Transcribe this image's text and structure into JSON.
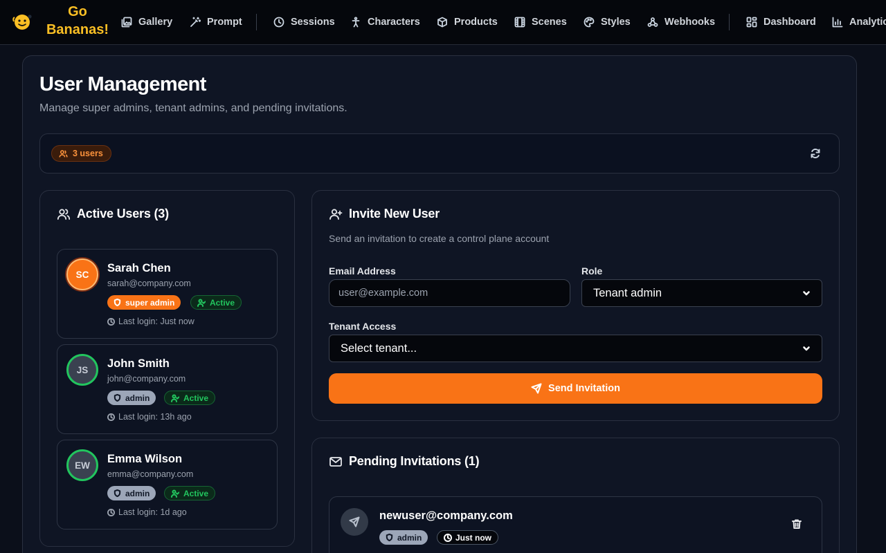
{
  "nav": {
    "logo_icon": "banana-face-icon",
    "logo_line1": "Go",
    "logo_line2": "Bananas!",
    "items": [
      {
        "label": "Gallery",
        "icon": "gallery-icon"
      },
      {
        "label": "Prompt",
        "icon": "wand-icon"
      },
      {
        "label": "Sessions",
        "icon": "clock-icon"
      },
      {
        "label": "Characters",
        "icon": "person-icon"
      },
      {
        "label": "Products",
        "icon": "box-icon"
      },
      {
        "label": "Scenes",
        "icon": "film-icon"
      },
      {
        "label": "Styles",
        "icon": "palette-icon"
      },
      {
        "label": "Webhooks",
        "icon": "webhook-icon"
      },
      {
        "label": "Dashboard",
        "icon": "dashboard-icon"
      },
      {
        "label": "Analytics",
        "icon": "chart-icon"
      }
    ]
  },
  "page": {
    "title": "User Management",
    "subtitle": "Manage super admins, tenant admins, and pending invitations."
  },
  "stats": {
    "users_count_label": "3 users"
  },
  "active_users": {
    "heading": "Active Users (3)",
    "users": [
      {
        "initials": "SC",
        "name": "Sarah Chen",
        "email": "sarah@company.com",
        "role": "super admin",
        "status": "Active",
        "last_login": "Last login: Just now"
      },
      {
        "initials": "JS",
        "name": "John Smith",
        "email": "john@company.com",
        "role": "admin",
        "status": "Active",
        "last_login": "Last login: 13h ago"
      },
      {
        "initials": "EW",
        "name": "Emma Wilson",
        "email": "emma@company.com",
        "role": "admin",
        "status": "Active",
        "last_login": "Last login: 1d ago"
      }
    ]
  },
  "invite": {
    "heading": "Invite New User",
    "description": "Send an invitation to create a control plane account",
    "email_label": "Email Address",
    "email_placeholder": "user@example.com",
    "email_value": "",
    "role_label": "Role",
    "role_value": "Tenant admin",
    "tenant_label": "Tenant Access",
    "tenant_value": "Select tenant...",
    "send_label": "Send Invitation"
  },
  "pending": {
    "heading": "Pending Invitations (1)",
    "invitations": [
      {
        "email": "newuser@company.com",
        "role": "admin",
        "time": "Just now"
      }
    ]
  },
  "colors": {
    "accent": "#f97316",
    "active_green": "#22c55e",
    "background": "#0b0f1a"
  }
}
